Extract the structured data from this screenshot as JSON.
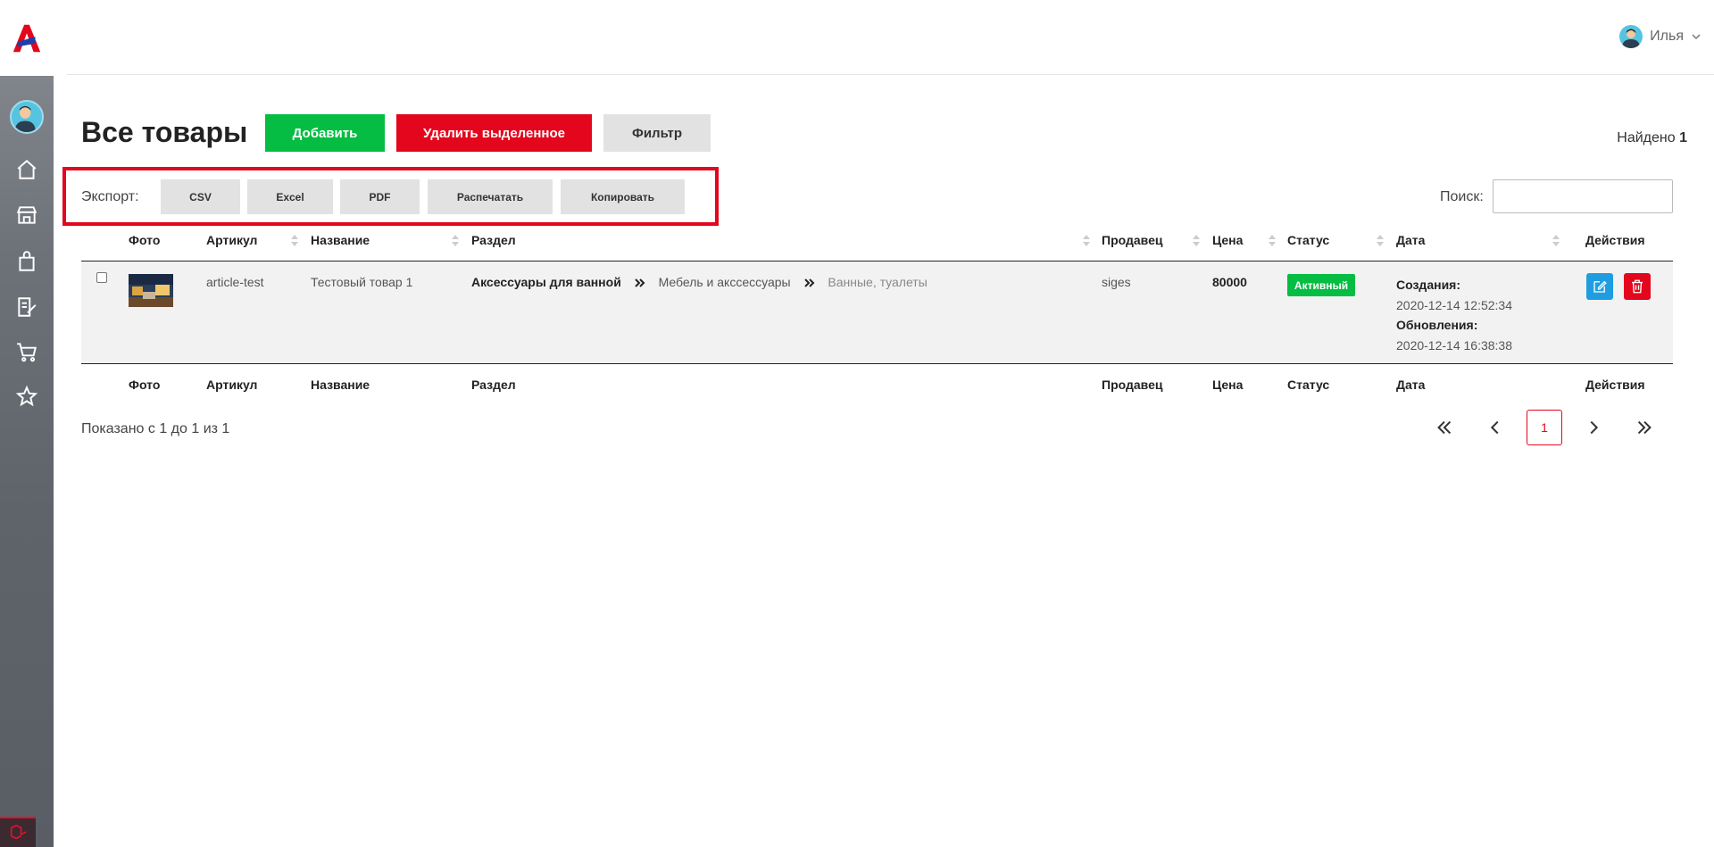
{
  "user": {
    "name": "Илья"
  },
  "page": {
    "title": "Все товары",
    "found_label": "Найдено",
    "found_count": "1"
  },
  "actions": {
    "add": "Добавить",
    "delete_selected": "Удалить выделенное",
    "filter": "Фильтр"
  },
  "export": {
    "label": "Экспорт:",
    "buttons": [
      "CSV",
      "Excel",
      "PDF",
      "Распечатать",
      "Копировать"
    ]
  },
  "search": {
    "label": "Поиск:",
    "value": ""
  },
  "table": {
    "columns": [
      "Фото",
      "Артикул",
      "Название",
      "Раздел",
      "Продавец",
      "Цена",
      "Статус",
      "Дата",
      "Действия"
    ],
    "rows": [
      {
        "article": "article-test",
        "name": "Тестовый товар 1",
        "section": [
          "Аксессуары для ванной",
          "Мебель и акссессуары",
          "Ванные, туалеты"
        ],
        "seller": "siges",
        "price": "80000",
        "status": "Активный",
        "created_label": "Создания:",
        "created": "2020-12-14 12:52:34",
        "updated_label": "Обновления:",
        "updated": "2020-12-14 16:38:38"
      }
    ]
  },
  "pagination": {
    "info": "Показано с 1 до 1 из 1",
    "current": "1"
  },
  "colors": {
    "green": "#05bd42",
    "red": "#e4061c",
    "blue": "#1e9ee0",
    "grey": "#e2e2e2"
  },
  "icons": {
    "sidebar": [
      "home-icon",
      "store-icon",
      "shopping-bag-icon",
      "edit-document-icon",
      "cart-icon",
      "star-icon"
    ],
    "row_actions": [
      "edit-icon",
      "trash-icon"
    ]
  }
}
